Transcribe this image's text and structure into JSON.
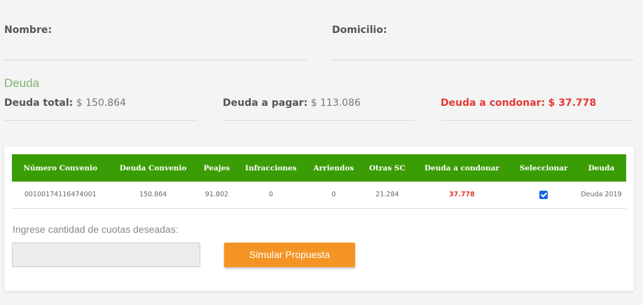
{
  "header": {
    "nombre_label": "Nombre:",
    "domicilio_label": "Domicilio:"
  },
  "deuda": {
    "section_title": "Deuda",
    "total_label": "Deuda total:",
    "total_value": "$ 150.864",
    "pagar_label": "Deuda a pagar:",
    "pagar_value": "$ 113.086",
    "condonar_label": "Deuda a condonar:",
    "condonar_value": "$ 37.778"
  },
  "table": {
    "headers": [
      "Número Convenio",
      "Deuda Convenio",
      "Peajes",
      "Infracciones",
      "Arriendos",
      "Otras SC",
      "Deuda a condonar",
      "Seleccionar",
      "Deuda"
    ],
    "rows": [
      {
        "numero_convenio": "00100174116474001",
        "deuda_convenio": "150.864",
        "peajes": "91.802",
        "infracciones": "0",
        "arriendos": "0",
        "otras_sc": "21.284",
        "deuda_condonar": "37.778",
        "seleccionar": true,
        "deuda": "Deuda 2019"
      }
    ]
  },
  "cuotas": {
    "label": "Ingrese cantidad de cuotas deseadas:",
    "value": "",
    "placeholder": ""
  },
  "actions": {
    "simular_label": "Simular Propuesta"
  },
  "colors": {
    "header_green": "#3a9d06",
    "section_green": "#7db46c",
    "alert_red": "#e53935",
    "button_orange": "#f39425",
    "checkbox_blue": "#1565e8"
  }
}
